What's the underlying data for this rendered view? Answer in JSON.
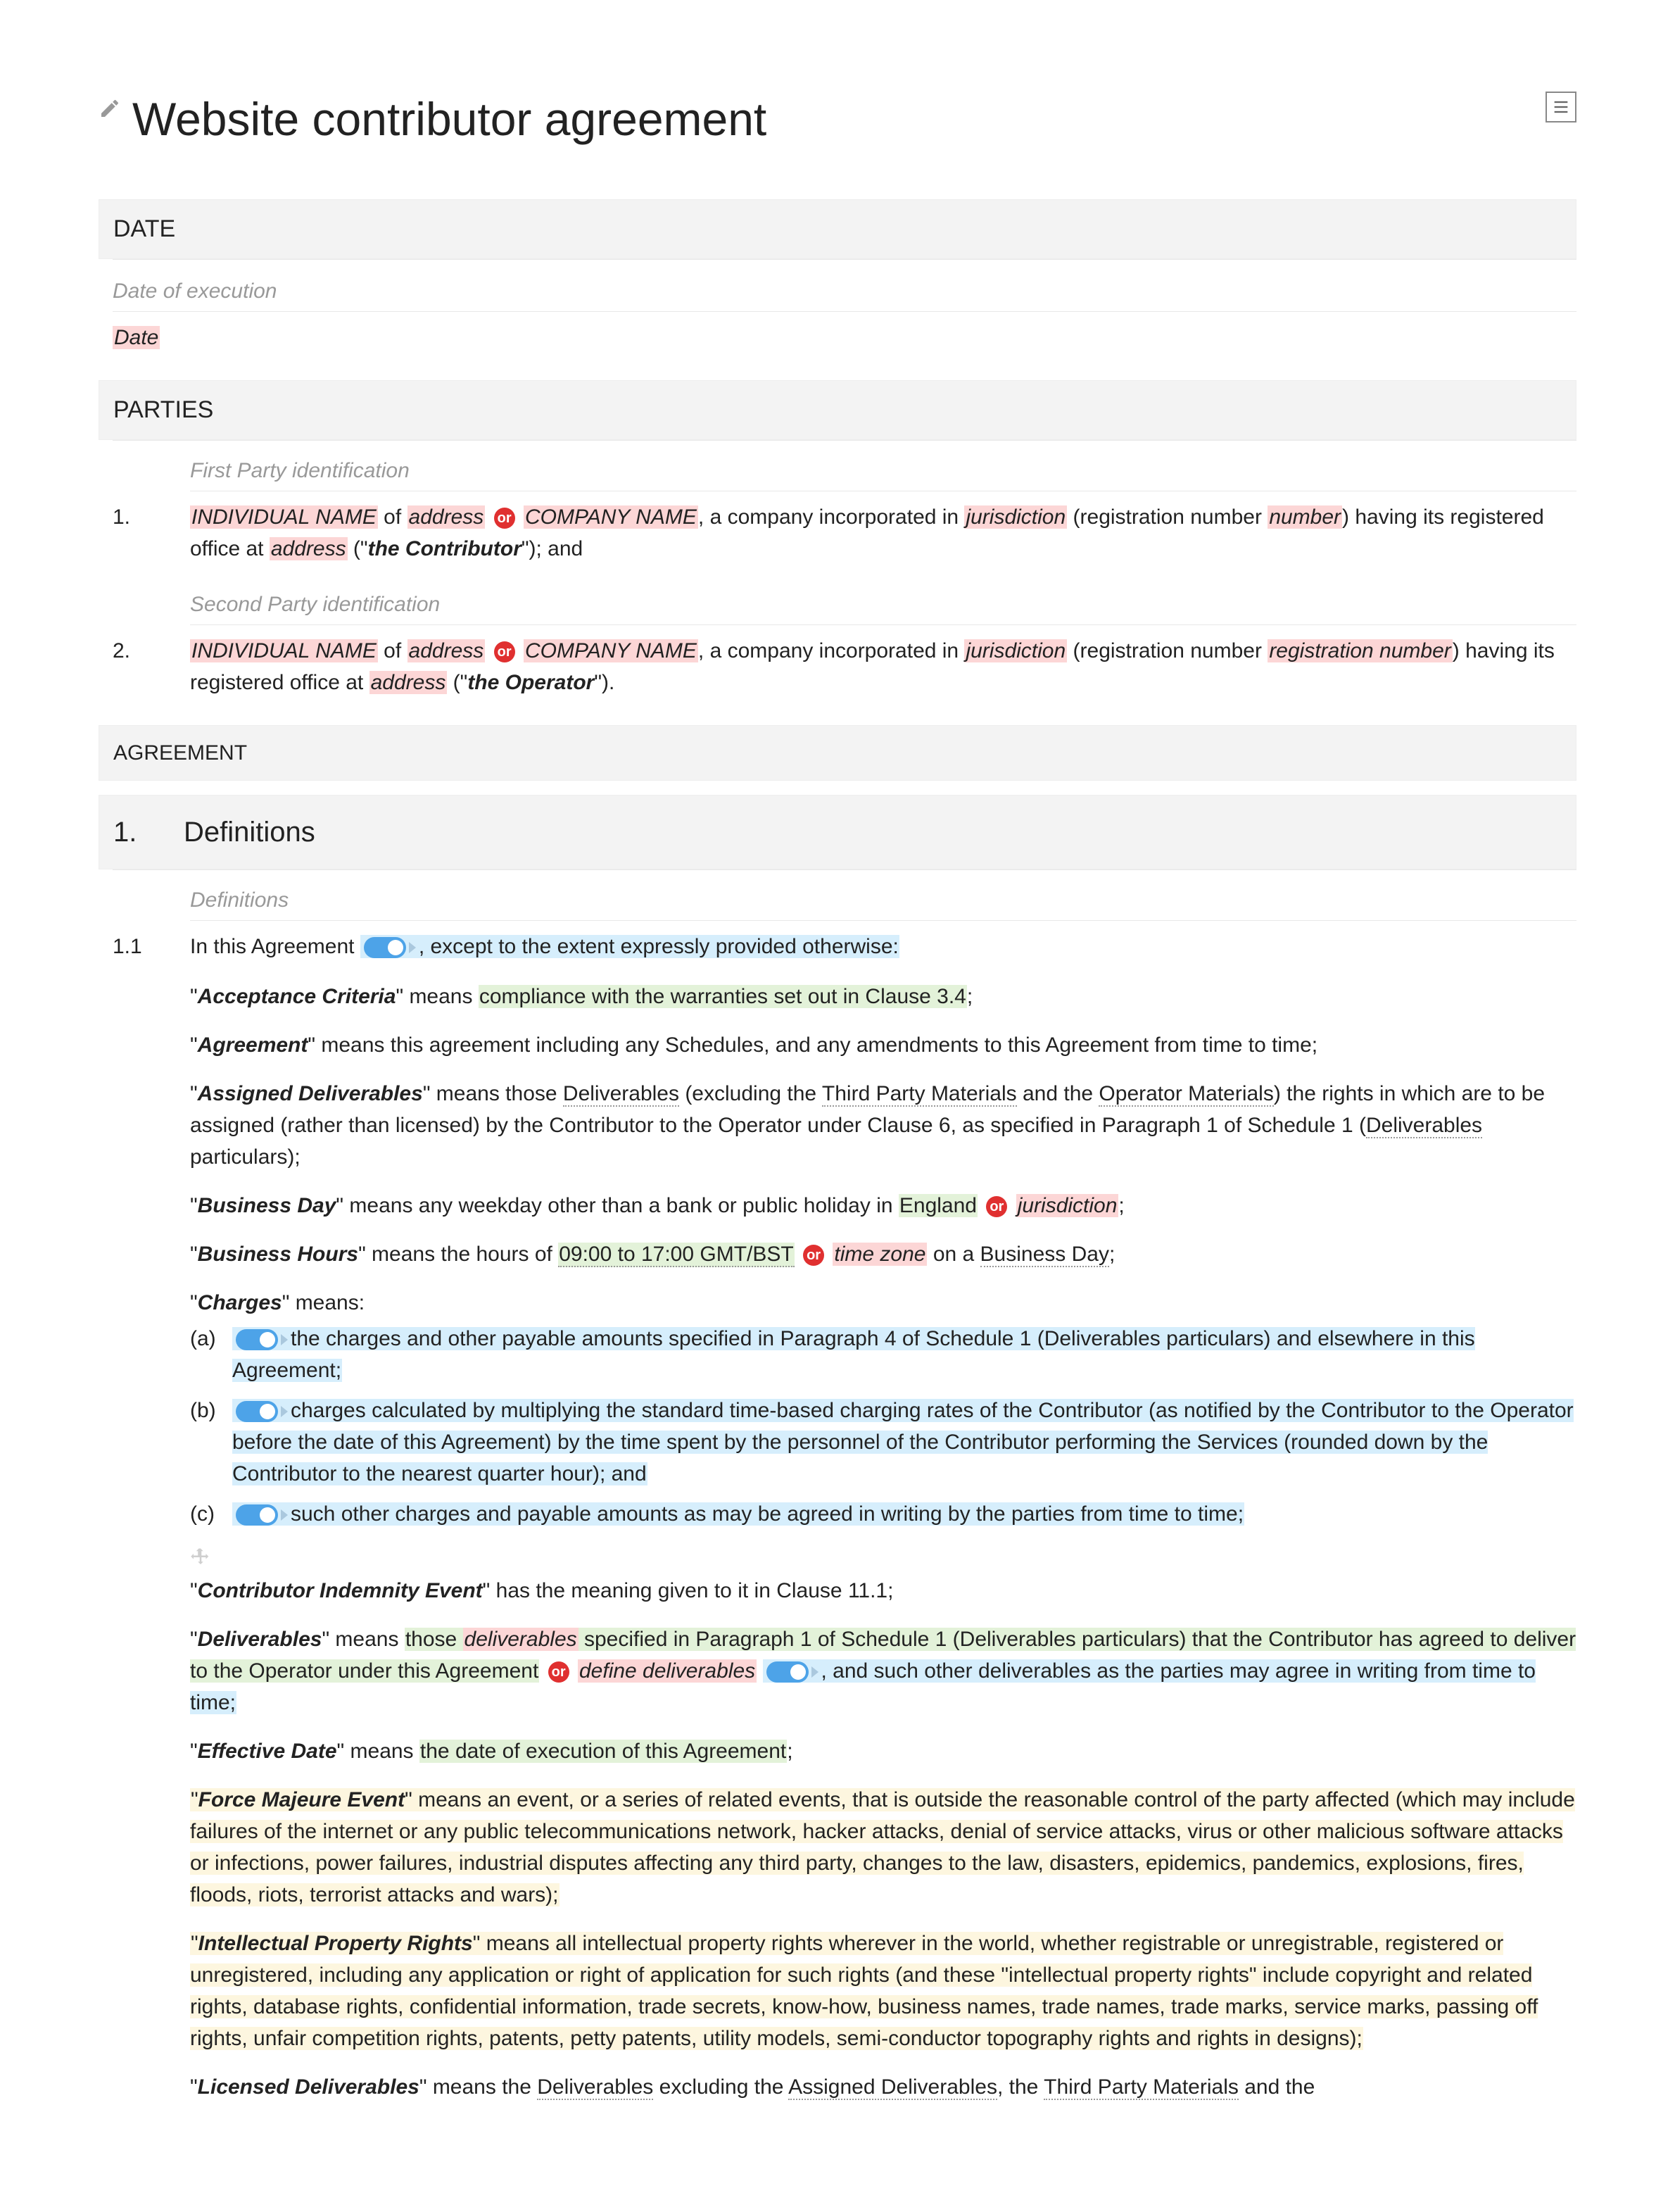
{
  "title": "Website contributor agreement",
  "sections": {
    "date_header": "DATE",
    "date_subtle": "Date of execution",
    "date_value": "Date",
    "parties_header": "PARTIES",
    "party1_subtle": "First Party identification",
    "party1_num": "1.",
    "p1_indiv": "INDIVIDUAL NAME",
    "p1_of": " of ",
    "p1_addr": "address",
    "p1_comp": "COMPANY NAME",
    "p1_mid": ", a company incorporated in ",
    "p1_juris": "jurisdiction",
    "p1_reg": " (registration number ",
    "p1_num_field": "number",
    "p1_reg2": ") having its registered office at ",
    "p1_addr2": "address",
    "p1_open": " (\"",
    "p1_role": "the Contributor",
    "p1_close": "\"); and",
    "party2_subtle": "Second Party identification",
    "party2_num": "2.",
    "p2_indiv": "INDIVIDUAL NAME",
    "p2_of": " of ",
    "p2_addr": "address",
    "p2_comp": "COMPANY NAME",
    "p2_mid": ", a company incorporated in ",
    "p2_juris": "jurisdiction",
    "p2_reg": " (registration number ",
    "p2_num_field": "registration number",
    "p2_reg2": ") having its registered office at ",
    "p2_addr2": "address",
    "p2_open": " (\"",
    "p2_role": "the Operator",
    "p2_close": "\").",
    "agreement_header": "AGREEMENT",
    "def_num": "1.",
    "def_title": "Definitions",
    "def_subtle": "Definitions",
    "c11_num": "1.1",
    "c11_a": "In this Agreement",
    "c11_b": ", except to the extent expressly provided otherwise:",
    "ac_term": "Acceptance Criteria",
    "ac_a": "\" means ",
    "ac_b": "compliance with the warranties set out in Clause 3.4",
    "ac_c": ";",
    "ag_term": "Agreement",
    "ag_body": "\" means this agreement including any Schedules, and any amendments to this Agreement from time to time;",
    "ad_term": "Assigned Deliverables",
    "ad_a": "\" means those ",
    "ad_del": "Deliverables",
    "ad_b": " (excluding the ",
    "ad_tpm": "Third Party Materials",
    "ad_c": " and the ",
    "ad_op": "Operator Materials",
    "ad_d": ") the rights in which are to be assigned (rather than licensed) by the Contributor to the Operator under Clause 6, as specified in Paragraph 1 of Schedule 1 (",
    "ad_dp": "Deliverables",
    "ad_e": " particulars);",
    "bd_term": "Business Day",
    "bd_a": "\" means any weekday other than a bank or public holiday in ",
    "bd_eng": "England",
    "bd_jur": "jurisdiction",
    "bd_c": ";",
    "bh_term": "Business Hours",
    "bh_a": "\" means the hours of ",
    "bh_hrs": "09:00 to 17:00 GMT/BST",
    "bh_tz": "time zone",
    "bh_b": " on a ",
    "bh_bd": "Business Day",
    "bh_c": ";",
    "ch_term": "Charges",
    "ch_a": "\" means:",
    "ch_a_m": "(a)",
    "ch_a_body": "the charges and other payable amounts specified in Paragraph 4 of Schedule 1 (Deliverables particulars) and elsewhere in this Agreement;",
    "ch_b_m": "(b)",
    "ch_b_body": "charges calculated by multiplying the standard time-based charging rates of the Contributor (as notified by the Contributor to the Operator before the date of this Agreement) by the time spent by the personnel of the Contributor performing the Services (rounded down by the Contributor to the nearest quarter hour); and",
    "ch_c_m": "(c)",
    "ch_c_body": "such other charges and payable amounts as may be agreed in writing by the parties from time to time;",
    "cie_term": "Contributor Indemnity Event",
    "cie_a": "\" has the meaning given to it in Clause 11.1;",
    "del_term": "Deliverables",
    "del_a": "\" means ",
    "del_b": "those ",
    "del_c": "deliverables",
    "del_d": " specified in Paragraph 1 of Schedule 1 (Deliverables particulars) that the Contributor has agreed to deliver to the Operator under this Agreement",
    "del_def": "define deliverables",
    "del_e": ", and such other deliverables as the parties may agree in writing from time to time;",
    "ed_term": "Effective Date",
    "ed_a": "\" means ",
    "ed_b": "the date of execution of this Agreement",
    "ed_c": ";",
    "fm_term": "Force Majeure Event",
    "fm_body": "\" means an event, or a series of related events, that is outside the reasonable control of the party affected (which may include failures of the internet or any public telecommunications network, hacker attacks, denial of service attacks, virus or other malicious software attacks or infections, power failures, industrial disputes affecting any third party, changes to the law, disasters, epidemics, pandemics, explosions, fires, floods, riots, terrorist attacks and wars);",
    "ipr_term": "Intellectual Property Rights",
    "ipr_body": "\" means all intellectual property rights wherever in the world, whether registrable or unregistrable, registered or unregistered, including any application or right of application for such rights (and these \"intellectual property rights\" include copyright and related rights, database rights, confidential information, trade secrets, know-how, business names, trade names, trade marks, service marks, passing off rights, unfair competition rights, patents, petty patents, utility models, semi-conductor topography rights and rights in designs);",
    "ld_term": "Licensed Deliverables",
    "ld_a": "\" means the ",
    "ld_del": "Deliverables",
    "ld_b": " excluding the ",
    "ld_ad": "Assigned Deliverables",
    "ld_c": ", the ",
    "ld_tpm": "Third Party Materials",
    "ld_d": " and the"
  },
  "or_label": "or"
}
